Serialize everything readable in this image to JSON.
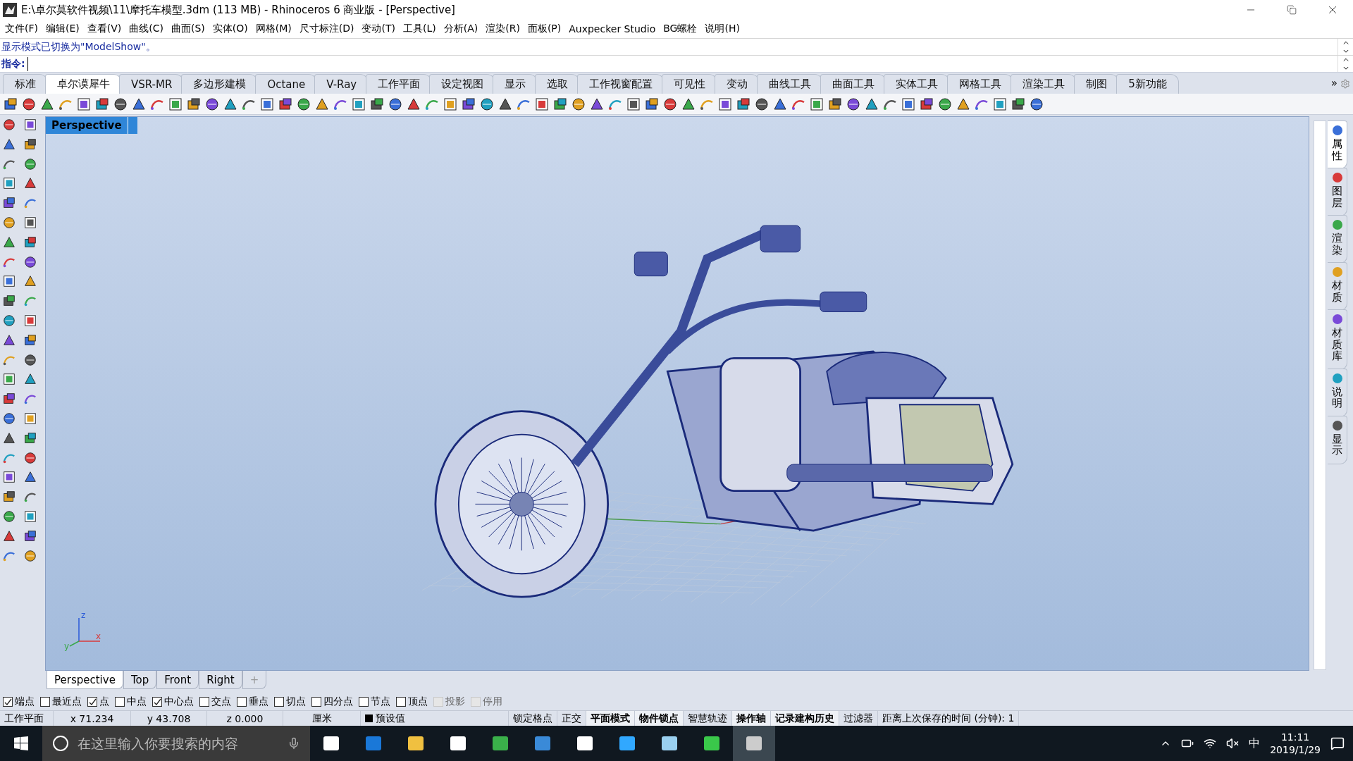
{
  "window": {
    "title": "E:\\卓尔莫软件视频\\11\\摩托车模型.3dm (113 MB) - Rhinoceros 6 商业版 - [Perspective]"
  },
  "menu": [
    "文件(F)",
    "编辑(E)",
    "查看(V)",
    "曲线(C)",
    "曲面(S)",
    "实体(O)",
    "网格(M)",
    "尺寸标注(D)",
    "变动(T)",
    "工具(L)",
    "分析(A)",
    "渲染(R)",
    "面板(P)",
    "Auxpecker Studio",
    "BG螺栓",
    "说明(H)"
  ],
  "command_history": "显示模式已切换为\"ModelShow\"。",
  "command_prompt": "指令:",
  "toolbar_tabs": [
    {
      "label": "标准",
      "selected": false
    },
    {
      "label": "卓尔谟犀牛",
      "selected": true
    },
    {
      "label": "VSR-MR",
      "selected": false
    },
    {
      "label": "多边形建模",
      "selected": false
    },
    {
      "label": "Octane",
      "selected": false
    },
    {
      "label": "V-Ray",
      "selected": false
    },
    {
      "label": "工作平面",
      "selected": false
    },
    {
      "label": "设定视图",
      "selected": false
    },
    {
      "label": "显示",
      "selected": false
    },
    {
      "label": "选取",
      "selected": false
    },
    {
      "label": "工作视窗配置",
      "selected": false
    },
    {
      "label": "可见性",
      "selected": false
    },
    {
      "label": "变动",
      "selected": false
    },
    {
      "label": "曲线工具",
      "selected": false
    },
    {
      "label": "曲面工具",
      "selected": false
    },
    {
      "label": "实体工具",
      "selected": false
    },
    {
      "label": "网格工具",
      "selected": false
    },
    {
      "label": "渲染工具",
      "selected": false
    },
    {
      "label": "制图",
      "selected": false
    },
    {
      "label": "5新功能",
      "selected": false
    }
  ],
  "toolbar_overflow": "»",
  "viewport": {
    "label": "Perspective",
    "axes": {
      "x": "x",
      "y": "y",
      "z": "z"
    }
  },
  "viewport_tabs": [
    {
      "label": "Perspective",
      "selected": true
    },
    {
      "label": "Top",
      "selected": false
    },
    {
      "label": "Front",
      "selected": false
    },
    {
      "label": "Right",
      "selected": false
    }
  ],
  "add_viewport": "+",
  "side_panel_tabs": [
    {
      "label": "属性",
      "selected": true
    },
    {
      "label": "图层",
      "selected": false
    },
    {
      "label": "渲染",
      "selected": false
    },
    {
      "label": "材质",
      "selected": false
    },
    {
      "label": "材质库",
      "selected": false
    },
    {
      "label": "说明",
      "selected": false
    },
    {
      "label": "显示",
      "selected": false
    }
  ],
  "osnaps": [
    {
      "label": "端点",
      "checked": true,
      "disabled": false
    },
    {
      "label": "最近点",
      "checked": false,
      "disabled": false
    },
    {
      "label": "点",
      "checked": true,
      "disabled": false
    },
    {
      "label": "中点",
      "checked": false,
      "disabled": false
    },
    {
      "label": "中心点",
      "checked": true,
      "disabled": false
    },
    {
      "label": "交点",
      "checked": false,
      "disabled": false
    },
    {
      "label": "垂点",
      "checked": false,
      "disabled": false
    },
    {
      "label": "切点",
      "checked": false,
      "disabled": false
    },
    {
      "label": "四分点",
      "checked": false,
      "disabled": false
    },
    {
      "label": "节点",
      "checked": false,
      "disabled": false
    },
    {
      "label": "顶点",
      "checked": false,
      "disabled": false
    },
    {
      "label": "投影",
      "checked": false,
      "disabled": true
    },
    {
      "label": "停用",
      "checked": false,
      "disabled": true
    }
  ],
  "status_bar": {
    "cplane": "工作平面",
    "x": "x 71.234",
    "y": "y 43.708",
    "z": "z 0.000",
    "units": "厘米",
    "layer": {
      "label": "预设值",
      "color": "#000000"
    },
    "toggles": [
      {
        "label": "锁定格点",
        "on": false
      },
      {
        "label": "正交",
        "on": false
      },
      {
        "label": "平面模式",
        "on": true
      },
      {
        "label": "物件锁点",
        "on": true
      },
      {
        "label": "智慧轨迹",
        "on": false
      },
      {
        "label": "操作轴",
        "on": true
      },
      {
        "label": "记录建构历史",
        "on": true
      },
      {
        "label": "过滤器",
        "on": false
      }
    ],
    "save_time": "距离上次保存的时间 (分钟): 1"
  },
  "taskbar": {
    "search_placeholder": "在这里输入你要搜索的内容",
    "ime": "中",
    "time": "11:11",
    "date": "2019/1/29"
  }
}
